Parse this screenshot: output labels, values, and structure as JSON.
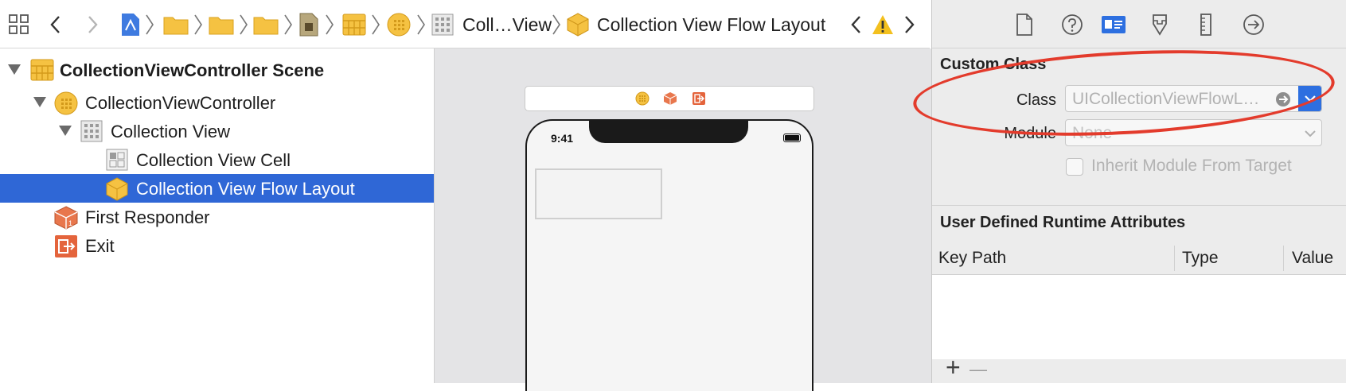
{
  "jumpbar": {
    "breadcrumb_collection_view": "Coll…View",
    "breadcrumb_flow_layout": "Collection View Flow Layout"
  },
  "outline": {
    "rows": [
      {
        "label": "CollectionViewController Scene",
        "icon": "scene-icon",
        "bold": true
      },
      {
        "label": "CollectionViewController",
        "icon": "view-controller-icon",
        "bold": false
      },
      {
        "label": "Collection View",
        "icon": "collection-view-icon",
        "bold": false
      },
      {
        "label": "Collection View Cell",
        "icon": "collection-view-cell-icon",
        "bold": false
      },
      {
        "label": "Collection View Flow Layout",
        "icon": "flow-layout-icon",
        "bold": false,
        "selected": true
      },
      {
        "label": "First Responder",
        "icon": "first-responder-icon",
        "bold": false
      },
      {
        "label": "Exit",
        "icon": "exit-icon",
        "bold": false
      }
    ]
  },
  "canvas": {
    "status_time": "9:41"
  },
  "inspector": {
    "custom_class_title": "Custom Class",
    "class_label": "Class",
    "class_value": "UICollectionViewFlowL…",
    "module_label": "Module",
    "module_value": "None",
    "inherit_label": "Inherit Module From Target",
    "runtime_title": "User Defined Runtime Attributes",
    "columns": [
      "Key Path",
      "Type",
      "Value"
    ],
    "add_label": "+",
    "remove_label": "—"
  },
  "colors": {
    "selection": "#2f67d6",
    "accent": "#2d6fe0",
    "annotation": "#e33b2c",
    "folder": "#f5c242"
  }
}
